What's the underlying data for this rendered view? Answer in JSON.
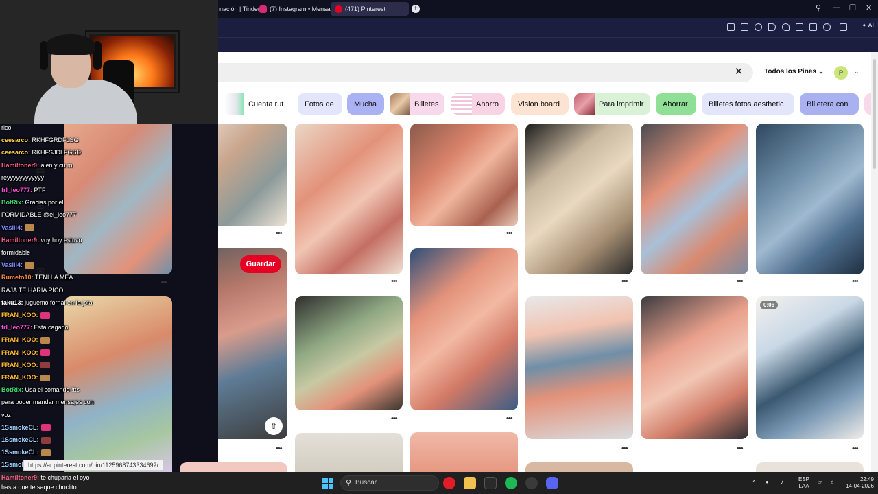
{
  "browser": {
    "tabs": [
      {
        "title": "nación | Tinder",
        "color": "#ff5a5f",
        "active": false
      },
      {
        "title": "(7) Instagram • Mensajes",
        "color": "#d62976",
        "active": false
      },
      {
        "title": "(471) Pinterest",
        "color": "#e60023",
        "active": true
      }
    ],
    "new_tab": "+",
    "ai_label": "AI"
  },
  "pinterest": {
    "filter_label": "Todos los Pines",
    "profile_initial": "P",
    "chips": [
      {
        "label": "Cuenta rut",
        "bg": "#8ce3b5",
        "thumb": "#d9dde6"
      },
      {
        "label": "Fotos de",
        "bg": "#e3e6fb",
        "thumb": null
      },
      {
        "label": "Mucha",
        "bg": "#aab2f3",
        "thumb": null
      },
      {
        "label": "Billetes",
        "bg": "#f8d9ec",
        "thumb": "#c9a07f"
      },
      {
        "label": "Ahorro",
        "bg": "#f7d3e4",
        "thumb": "#e7b9d3"
      },
      {
        "label": "Vision board",
        "bg": "#fde3d2",
        "thumb": null
      },
      {
        "label": "Para imprimir",
        "bg": "#d9f1d6",
        "thumb": "#c06070"
      },
      {
        "label": "Ahorrar",
        "bg": "#8fdf96",
        "thumb": null
      },
      {
        "label": "Billetes fotos aesthetic",
        "bg": "#e3e6fb",
        "thumb": null
      },
      {
        "label": "Billetera con",
        "bg": "#a9b1f1",
        "thumb": null
      }
    ],
    "save_label": "Guardar",
    "video_duration": "0:06",
    "share_icon": "share-icon",
    "url_tooltip": "https://ar.pinterest.com/pin/1125968743334692/"
  },
  "colors": {
    "brand_red": "#e60023",
    "money_pink": "#e3927a",
    "money_blue": "#6f8fa8",
    "money_green": "#8fa883"
  },
  "chat": {
    "lines": [
      {
        "user": "",
        "text": "rico",
        "color": "#ffffff",
        "emote": false
      },
      {
        "user": "ceesarco:",
        "text": " RKHFGRDFLSG",
        "color": "#ffd34d",
        "emote": false
      },
      {
        "user": "ceesarco:",
        "text": " RKHFSJDLFGSD",
        "color": "#ffd34d",
        "emote": false
      },
      {
        "user": "Hamiltoner9:",
        "text": " alen y cu m",
        "color": "#ff5c8a",
        "emote": false
      },
      {
        "user": "",
        "text": "reyyyyyyyyyyyy",
        "color": "#ffffff",
        "emote": false
      },
      {
        "user": "frl_leo777:",
        "text": " PTF",
        "color": "#ff4fd8",
        "emote": false
      },
      {
        "user": "BotRix:",
        "text": " Gracias por el",
        "color": "#3ddc6f",
        "emote": false
      },
      {
        "user": "",
        "text": "FORMIDABLE @el_leo777",
        "color": "#ffffff",
        "emote": false
      },
      {
        "user": "Vasill4:",
        "text": "",
        "color": "#7f8cff",
        "emote": true
      },
      {
        "user": "Hamiltoner9:",
        "text": " voy hoy estuvo",
        "color": "#ff5c8a",
        "emote": false
      },
      {
        "user": "",
        "text": "formidable",
        "color": "#ffffff",
        "emote": false
      },
      {
        "user": "Vasill4:",
        "text": "",
        "color": "#7f8cff",
        "emote": true
      },
      {
        "user": "Rumeto10:",
        "text": " TENI LA MEA",
        "color": "#ff8a3d",
        "emote": false
      },
      {
        "user": "",
        "text": "RAJA TE HARIA PICO",
        "color": "#ffffff",
        "emote": false
      },
      {
        "user": "faku13:",
        "text": " juguemo fornai en la jota",
        "color": "#ffffff",
        "emote": false
      },
      {
        "user": "FRAN_KOO:",
        "text": "",
        "color": "#ffb833",
        "emote": true
      },
      {
        "user": "frl_leo777:",
        "text": " Esta cagado",
        "color": "#ff4fd8",
        "emote": false
      },
      {
        "user": "FRAN_KOO:",
        "text": "",
        "color": "#ffb833",
        "emote": true
      },
      {
        "user": "FRAN_KOO:",
        "text": "",
        "color": "#ffb833",
        "emote": true
      },
      {
        "user": "FRAN_KOO:",
        "text": "",
        "color": "#ffb833",
        "emote": true
      },
      {
        "user": "FRAN_KOO:",
        "text": "",
        "color": "#ffb833",
        "emote": true
      },
      {
        "user": "BotRix:",
        "text": " Usa el comando !tts",
        "color": "#3ddc6f",
        "emote": false
      },
      {
        "user": "",
        "text": "para poder mandar mensajes con",
        "color": "#ffffff",
        "emote": false
      },
      {
        "user": "",
        "text": "voz",
        "color": "#ffffff",
        "emote": false
      },
      {
        "user": "1SsmokeCL:",
        "text": "",
        "color": "#9fd3ff",
        "emote": true
      },
      {
        "user": "1SsmokeCL:",
        "text": "",
        "color": "#9fd3ff",
        "emote": true
      },
      {
        "user": "1SsmokeCL:",
        "text": "",
        "color": "#9fd3ff",
        "emote": true
      },
      {
        "user": "1SsmokeCL:",
        "text": "",
        "color": "#9fd3ff",
        "emote": true
      },
      {
        "user": "1SsmokeCL:",
        "text": "",
        "color": "#9fd3ff",
        "emote": true
      }
    ],
    "bottom_user": "Hamiltoner9:",
    "bottom_text": " te chuparia el oyo",
    "bottom_text2": "hasta que te saque choclito"
  },
  "taskbar": {
    "search_placeholder": "Buscar",
    "lang": "ESP",
    "layout": "LAA",
    "time": "22:49",
    "date": "14-04-2026"
  }
}
